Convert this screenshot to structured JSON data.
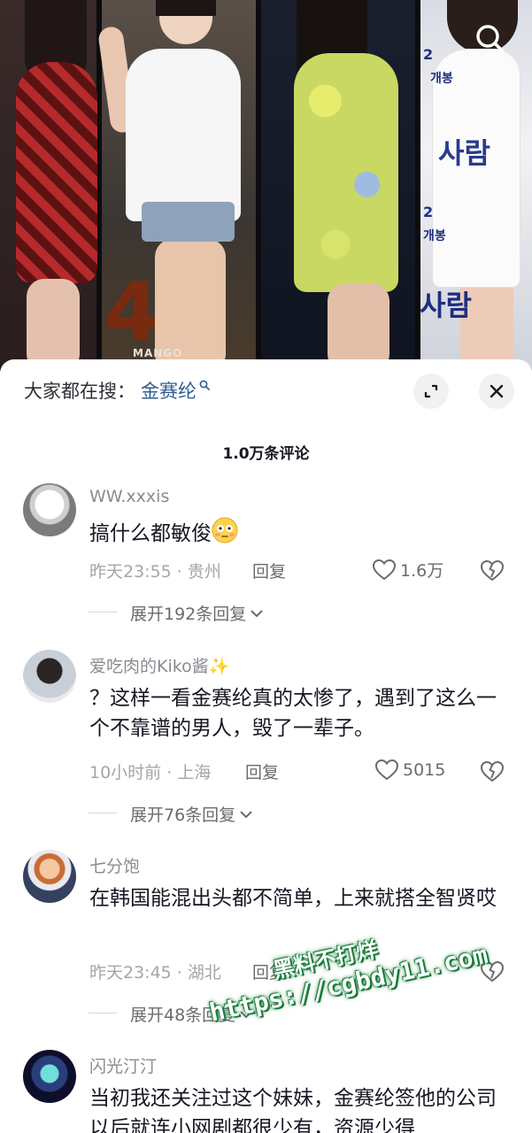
{
  "photo": {
    "bg_texts": {
      "sa": "사람",
      "num": "2",
      "kr1": "개봉",
      "kr2": "개봉",
      "mango": "MANGO"
    }
  },
  "header": {
    "prefix": "大家都在搜：",
    "keyword": "金赛纶"
  },
  "comments_count": "1.0万条评论",
  "comments": [
    {
      "user": "WW.xxxis",
      "text": "搞什么都敏俊",
      "time": "昨天23:55",
      "location": "贵州",
      "reply_label": "回复",
      "likes": "1.6万",
      "expand": "展开192条回复"
    },
    {
      "user": "爱吃肉的Kiko酱✨",
      "text": "？这样一看金赛纶真的太惨了，遇到了这么一个不靠谱的男人，毁了一辈子。",
      "time": "10小时前",
      "location": "上海",
      "reply_label": "回复",
      "likes": "5015",
      "expand": "展开76条回复"
    },
    {
      "user": "七分饱",
      "text": "在韩国能混出头都不简单，上来就搭全智贤哎",
      "time": "昨天23:45",
      "location": "湖北",
      "reply_label": "回复",
      "likes": "",
      "expand": "展开48条回复"
    },
    {
      "user": "闪光汀汀",
      "text": "当初我还关注过这个妹妹，金赛纶签他的公司以后就连小网剧都很少有，资源少得"
    }
  ],
  "watermark": {
    "line1": "黑料不打烊",
    "line2": "https://cgbdy11.com"
  }
}
